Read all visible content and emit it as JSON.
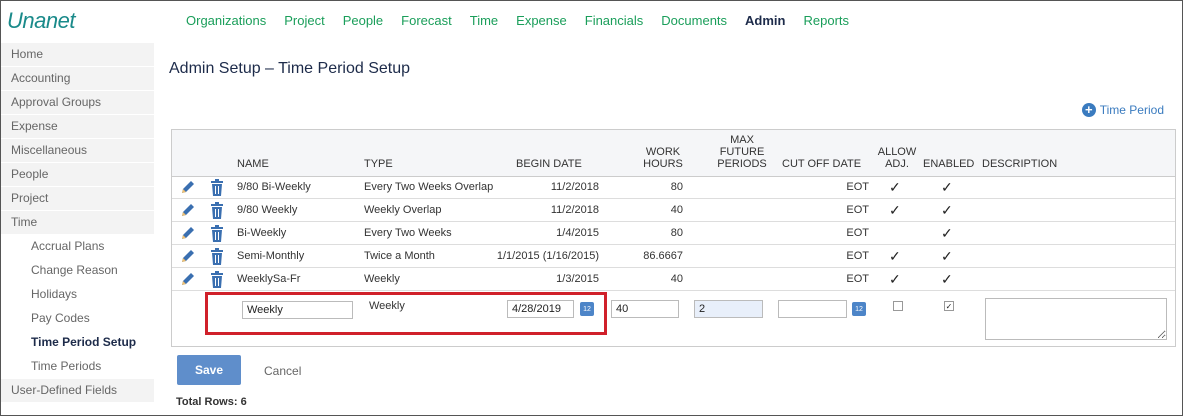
{
  "app": {
    "logo": "Unanet"
  },
  "nav": [
    "Organizations",
    "Project",
    "People",
    "Forecast",
    "Time",
    "Expense",
    "Financials",
    "Documents",
    "Admin",
    "Reports"
  ],
  "nav_active": "Admin",
  "sidebar": [
    {
      "label": "Home",
      "sub": false
    },
    {
      "label": "Accounting",
      "sub": false
    },
    {
      "label": "Approval Groups",
      "sub": false
    },
    {
      "label": "Expense",
      "sub": false
    },
    {
      "label": "Miscellaneous",
      "sub": false
    },
    {
      "label": "People",
      "sub": false
    },
    {
      "label": "Project",
      "sub": false
    },
    {
      "label": "Time",
      "sub": false
    },
    {
      "label": "Accrual Plans",
      "sub": true
    },
    {
      "label": "Change Reason",
      "sub": true
    },
    {
      "label": "Holidays",
      "sub": true
    },
    {
      "label": "Pay Codes",
      "sub": true
    },
    {
      "label": "Time Period Setup",
      "sub": true,
      "active": true
    },
    {
      "label": "Time Periods",
      "sub": true
    },
    {
      "label": "User-Defined Fields",
      "sub": false
    }
  ],
  "page": {
    "title": "Admin Setup – Time Period Setup",
    "add_label": "Time Period"
  },
  "table": {
    "headers": {
      "name": "NAME",
      "type": "TYPE",
      "begin_date": "BEGIN DATE",
      "work_hours": "WORK HOURS",
      "max_future": "MAX FUTURE PERIODS",
      "cut_off": "CUT OFF DATE",
      "allow_adj": "ALLOW ADJ.",
      "enabled": "ENABLED",
      "description": "DESCRIPTION"
    },
    "rows": [
      {
        "name": "9/80 Bi-Weekly",
        "type": "Every Two Weeks Overlap",
        "begin": "11/2/2018",
        "hours": "80",
        "cutoff": "EOT",
        "allow": true,
        "enabled": true
      },
      {
        "name": "9/80 Weekly",
        "type": "Weekly Overlap",
        "begin": "11/2/2018",
        "hours": "40",
        "cutoff": "EOT",
        "allow": true,
        "enabled": true
      },
      {
        "name": "Bi-Weekly",
        "type": "Every Two Weeks",
        "begin": "1/4/2015",
        "hours": "80",
        "cutoff": "EOT",
        "allow": false,
        "enabled": true
      },
      {
        "name": "Semi-Monthly",
        "type": "Twice a Month",
        "begin": "1/1/2015 (1/16/2015)",
        "hours": "86.6667",
        "cutoff": "EOT",
        "allow": true,
        "enabled": true
      },
      {
        "name": "WeeklySa-Fr",
        "type": "Weekly",
        "begin": "1/3/2015",
        "hours": "40",
        "cutoff": "EOT",
        "allow": true,
        "enabled": true
      }
    ],
    "check_glyph": "✓",
    "edit": {
      "name": "Weekly",
      "type": "Weekly",
      "begin": "4/28/2019",
      "hours": "40",
      "max_future": "2",
      "cutoff": "",
      "allow_checked": false,
      "enabled_checked": true,
      "description": "",
      "cal_label": "12"
    }
  },
  "buttons": {
    "save": "Save",
    "cancel": "Cancel"
  },
  "footer": {
    "total_rows": "Total Rows: 6"
  },
  "colors": {
    "nav": "#1a9e5a",
    "accent": "#3a7bbf",
    "highlight": "#d0202a"
  }
}
